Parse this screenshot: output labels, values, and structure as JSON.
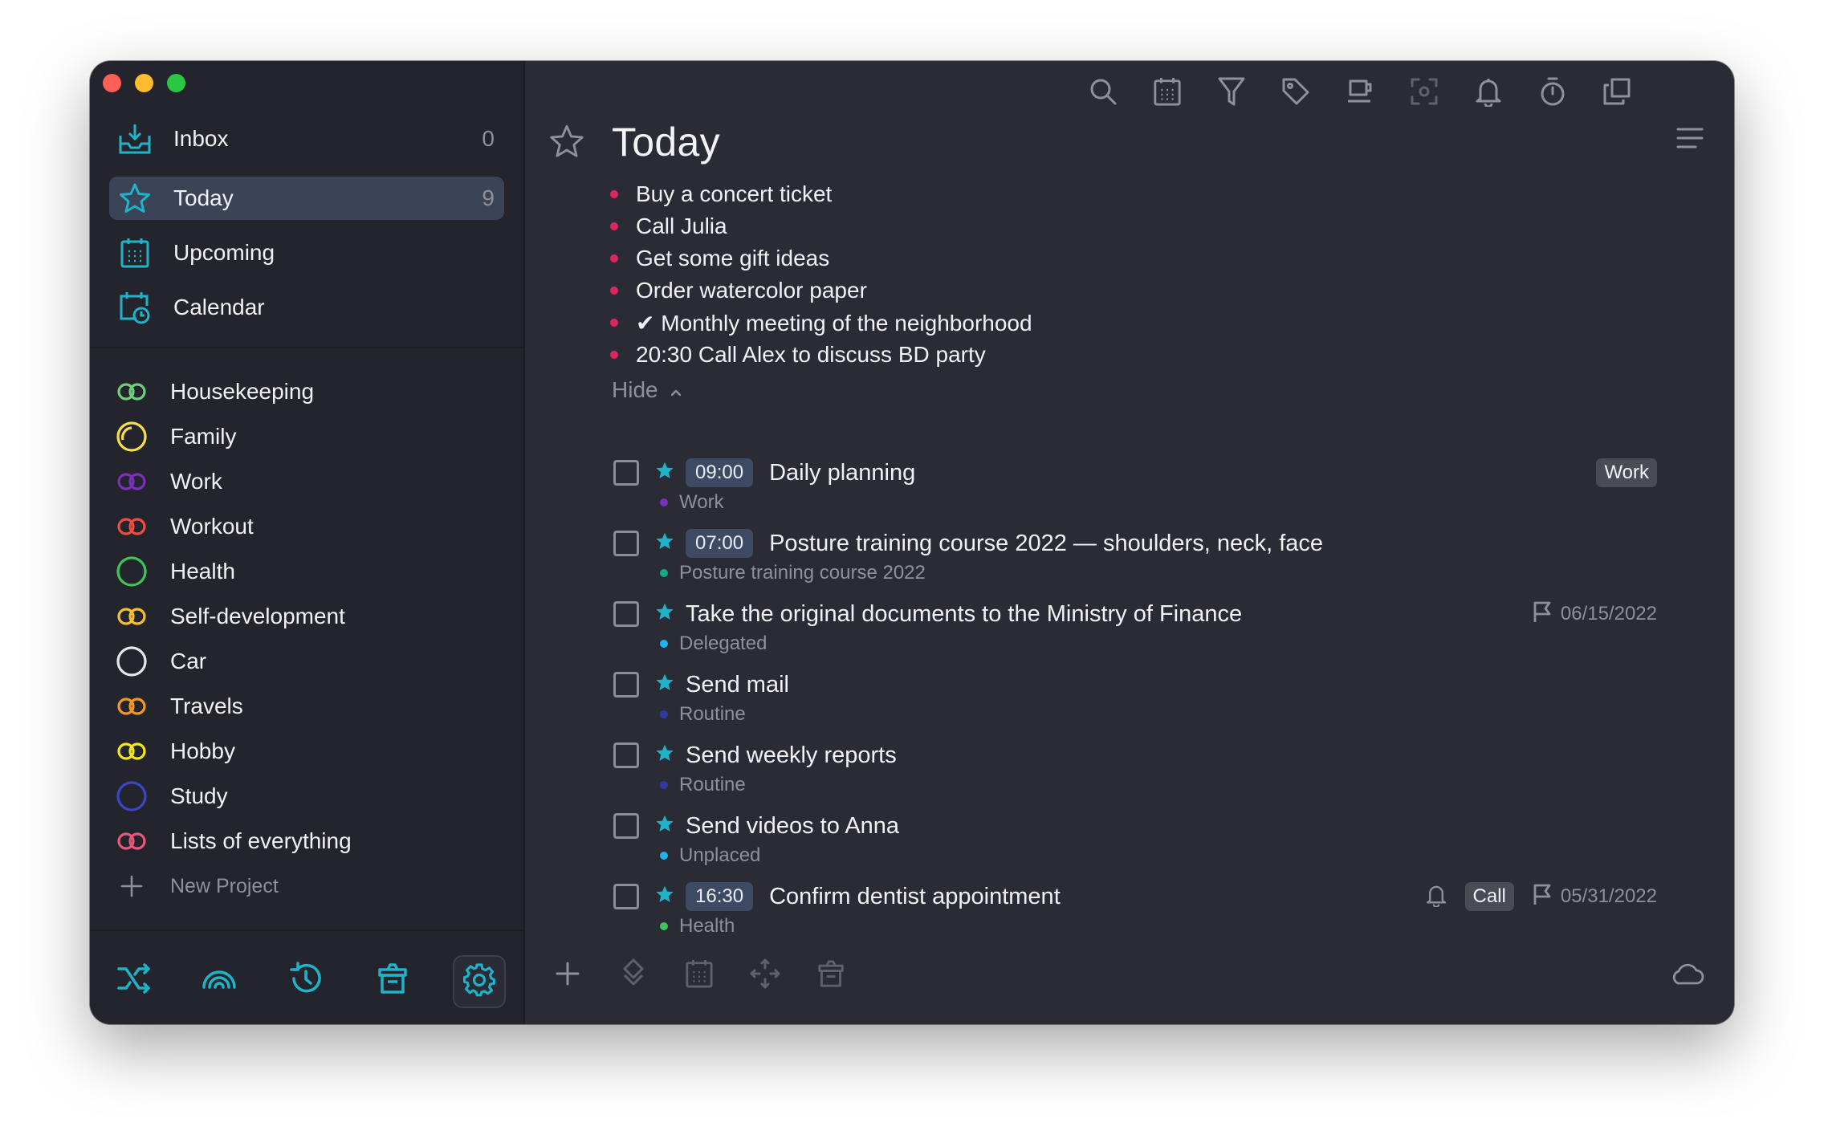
{
  "colors": {
    "accent": "#1fb3c9",
    "bullet": "#e0245e",
    "active_bg": "#3a4456"
  },
  "sidebar": {
    "nav": [
      {
        "label": "Inbox",
        "count": "0",
        "icon": "inbox-icon"
      },
      {
        "label": "Today",
        "count": "9",
        "icon": "star-icon",
        "active": true
      },
      {
        "label": "Upcoming",
        "count": "",
        "icon": "calendar-grid-icon"
      },
      {
        "label": "Calendar",
        "count": "",
        "icon": "calendar-clock-icon"
      }
    ],
    "projects": [
      {
        "label": "Housekeeping",
        "color": "#6fcf7c",
        "shape": "rings"
      },
      {
        "label": "Family",
        "color": "#f5e04a",
        "shape": "ring-partial"
      },
      {
        "label": "Work",
        "color": "#7b2fbf",
        "shape": "rings"
      },
      {
        "label": "Workout",
        "color": "#ef4b3f",
        "shape": "rings"
      },
      {
        "label": "Health",
        "color": "#3fc55a",
        "shape": "ring"
      },
      {
        "label": "Self-development",
        "color": "#f5c12e",
        "shape": "rings"
      },
      {
        "label": "Car",
        "color": "#e8e8ec",
        "shape": "ring"
      },
      {
        "label": "Travels",
        "color": "#f39a1e",
        "shape": "rings"
      },
      {
        "label": "Hobby",
        "color": "#f5e61a",
        "shape": "rings"
      },
      {
        "label": "Study",
        "color": "#3d46c8",
        "shape": "ring"
      },
      {
        "label": "Lists of everything",
        "color": "#e8577b",
        "shape": "rings"
      }
    ],
    "new_project_label": "New Project",
    "bottom_icons": [
      "shuffle-icon",
      "rainbow-icon",
      "history-icon",
      "trash-icon",
      "settings-icon"
    ]
  },
  "main": {
    "title": "Today",
    "toolbar_icons": [
      "search-icon",
      "calendar-icon",
      "filter-icon",
      "tag-icon",
      "coffee-icon",
      "focus-icon",
      "bell-icon",
      "timer-icon",
      "copy-icon"
    ],
    "quick_items": [
      "Buy a concert ticket",
      "Call Julia",
      "Get some gift ideas",
      "Order watercolor paper",
      "✔ Monthly meeting of the neighborhood",
      "20:30 Call Alex to discuss BD party"
    ],
    "hide_label": "Hide",
    "tasks": [
      {
        "time": "09:00",
        "title": "Daily planning",
        "project": "Work",
        "project_color": "#7b2fbf",
        "tag": "Work",
        "bell": false,
        "due": ""
      },
      {
        "time": "07:00",
        "title": "Posture training course 2022 — shoulders, neck, face",
        "project": "Posture training course 2022",
        "project_color": "#1aa68a",
        "tag": "",
        "bell": false,
        "due": ""
      },
      {
        "time": "",
        "title": "Take the original documents to the Ministry of Finance",
        "project": "Delegated",
        "project_color": "#1fb3e9",
        "tag": "",
        "bell": false,
        "due": "06/15/2022"
      },
      {
        "time": "",
        "title": "Send mail",
        "project": "Routine",
        "project_color": "#2f3a9e",
        "tag": "",
        "bell": false,
        "due": ""
      },
      {
        "time": "",
        "title": "Send weekly reports",
        "project": "Routine",
        "project_color": "#2f3a9e",
        "tag": "",
        "bell": false,
        "due": ""
      },
      {
        "time": "",
        "title": "Send videos to Anna",
        "project": "Unplaced",
        "project_color": "#1fb3e9",
        "tag": "",
        "bell": false,
        "due": ""
      },
      {
        "time": "16:30",
        "title": "Confirm dentist appointment",
        "project": "Health",
        "project_color": "#3fc55a",
        "tag": "Call",
        "bell": true,
        "due": "05/31/2022"
      }
    ],
    "bottom_icons": [
      "add-icon",
      "tag-move-icon",
      "calendar-icon",
      "move-icon",
      "trash-icon",
      "cloud-icon"
    ]
  }
}
